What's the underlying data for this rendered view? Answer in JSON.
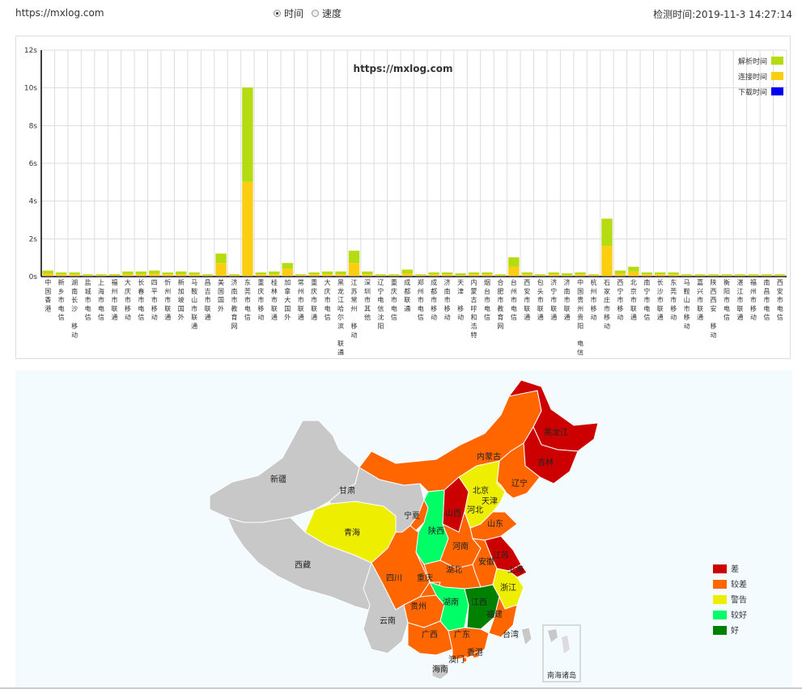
{
  "header": {
    "url": "https://mxlog.com",
    "radio_time": "时间",
    "radio_speed": "速度",
    "check_label": "检测时间:",
    "check_time": "2019-11-3 14:27:14"
  },
  "chart_data": {
    "type": "bar",
    "title": "https://mxlog.com",
    "ylim": [
      0,
      12
    ],
    "yticks": [
      "0s",
      "2s",
      "4s",
      "6s",
      "8s",
      "10s",
      "12s"
    ],
    "legend": [
      {
        "name": "解析时间",
        "color": "#b5dc10"
      },
      {
        "name": "连接时间",
        "color": "#fcce10"
      },
      {
        "name": "下载时间",
        "color": "#0000ee"
      }
    ],
    "legend_position": "top-right",
    "grid": true,
    "categories": [
      "中国香港",
      "新乡市电信",
      "湖南长沙 移动",
      "盐城市电信",
      "上海市电信",
      "福州市联通",
      "大庆市移动",
      "长春市电信",
      "四平市移动",
      "忻州市联通",
      "新加坡国外",
      "马鞍山市联通",
      "昌吉市联通",
      "美国国外",
      "济南市教育网",
      "东莞市电信",
      "重庆市移动",
      "桂林市联通",
      "加拿大国外",
      "常州市联通",
      "重庆市联通",
      "大庆市电信",
      "黑龙江哈尔滨 联通",
      "江苏常州 移动",
      "深圳市其他",
      "辽宁电信沈阳",
      "重庆市电信",
      "成都联通",
      "郑州市电信",
      "成都市移动",
      "济南市移动",
      "天津 移动",
      "内蒙古呼和浩特",
      "烟台市电信",
      "合肥市教育网",
      "台州市电信",
      "西安市联通",
      "包头市联通",
      "济宁市联通",
      "济南市联通",
      "中国贵州贵阳 电信",
      "杭州市移动",
      "石家庄市移动",
      "西宁市移动",
      "北京市联通",
      "南宁市电信",
      "长沙市联通",
      "东莞市移动",
      "马鞍山市移动",
      "嘉兴市联通",
      "陕西西安 移动",
      "衡阳市电信",
      "湛江市联通",
      "福州市移动",
      "南昌市电信",
      "西安市电信"
    ],
    "series": [
      {
        "name": "解析时间",
        "values": [
          0.15,
          0.1,
          0.1,
          0.05,
          0.05,
          0.05,
          0.15,
          0.15,
          0.15,
          0.1,
          0.15,
          0.1,
          0.05,
          0.5,
          0.05,
          5.0,
          0.1,
          0.15,
          0.3,
          0.05,
          0.1,
          0.15,
          0.15,
          0.65,
          0.15,
          0.05,
          0.05,
          0.2,
          0.05,
          0.1,
          0.1,
          0.1,
          0.1,
          0.1,
          0.05,
          0.5,
          0.1,
          0.05,
          0.1,
          0.1,
          0.1,
          0.05,
          1.45,
          0.15,
          0.25,
          0.1,
          0.1,
          0.1,
          0.05,
          0.05,
          0.05,
          0.05,
          0.05,
          0.05,
          0.05,
          0.05
        ]
      },
      {
        "name": "连接时间",
        "values": [
          0.15,
          0.1,
          0.1,
          0.05,
          0.05,
          0.05,
          0.1,
          0.1,
          0.15,
          0.1,
          0.1,
          0.1,
          0.05,
          0.7,
          0.05,
          5.0,
          0.1,
          0.1,
          0.4,
          0.05,
          0.1,
          0.1,
          0.1,
          0.7,
          0.1,
          0.05,
          0.05,
          0.15,
          0.05,
          0.1,
          0.1,
          0.05,
          0.1,
          0.1,
          0.05,
          0.5,
          0.1,
          0.05,
          0.1,
          0.05,
          0.1,
          0.05,
          1.6,
          0.15,
          0.25,
          0.1,
          0.1,
          0.1,
          0.05,
          0.05,
          0.05,
          0.05,
          0.05,
          0.05,
          0.05,
          0.05
        ]
      },
      {
        "name": "下载时间",
        "values": [
          0.02,
          0.02,
          0.02,
          0.02,
          0.02,
          0.03,
          0.02,
          0.02,
          0.02,
          0.02,
          0.02,
          0.02,
          0.02,
          0.02,
          0.02,
          0.02,
          0.02,
          0.02,
          0.02,
          0.02,
          0.02,
          0.02,
          0.02,
          0.02,
          0.02,
          0.02,
          0.02,
          0.02,
          0.02,
          0.02,
          0.02,
          0.02,
          0.02,
          0.02,
          0.02,
          0.02,
          0.02,
          0.02,
          0.02,
          0.02,
          0.02,
          0.02,
          0.02,
          0.02,
          0.02,
          0.02,
          0.02,
          0.02,
          0.02,
          0.02,
          0.02,
          0.02,
          0.02,
          0.02,
          0.02,
          0.02
        ]
      }
    ]
  },
  "map": {
    "legend": [
      {
        "name": "差",
        "color": "#cc0000"
      },
      {
        "name": "较差",
        "color": "#ff6600"
      },
      {
        "name": "警告",
        "color": "#eeee00"
      },
      {
        "name": "较好",
        "color": "#00ff66"
      },
      {
        "name": "好",
        "color": "#008000"
      }
    ],
    "provinces": [
      {
        "name": "新疆",
        "color": "#c8c8c8"
      },
      {
        "name": "西藏",
        "color": "#c8c8c8"
      },
      {
        "name": "青海",
        "color": "#eeee00"
      },
      {
        "name": "甘肃",
        "color": "#c8c8c8"
      },
      {
        "name": "内蒙古",
        "color": "#ff6600"
      },
      {
        "name": "黑龙江",
        "color": "#cc0000"
      },
      {
        "name": "吉林",
        "color": "#cc0000"
      },
      {
        "name": "辽宁",
        "color": "#ff6600"
      },
      {
        "name": "北京",
        "color": "#eeee00"
      },
      {
        "name": "天津",
        "color": "#eeee00"
      },
      {
        "name": "河北",
        "color": "#eeee00"
      },
      {
        "name": "宁夏",
        "color": "#ff6600"
      },
      {
        "name": "山西",
        "color": "#cc0000"
      },
      {
        "name": "陕西",
        "color": "#00ff66"
      },
      {
        "name": "山东",
        "color": "#ff6600"
      },
      {
        "name": "河南",
        "color": "#ff6600"
      },
      {
        "name": "江苏",
        "color": "#cc0000"
      },
      {
        "name": "安徽",
        "color": "#ff6600"
      },
      {
        "name": "上海",
        "color": "#cc0000"
      },
      {
        "name": "湖北",
        "color": "#ff6600"
      },
      {
        "name": "四川",
        "color": "#ff6600"
      },
      {
        "name": "重庆",
        "color": "#ff6600"
      },
      {
        "name": "浙江",
        "color": "#eeee00"
      },
      {
        "name": "贵州",
        "color": "#ff6600"
      },
      {
        "name": "湖南",
        "color": "#00ff66"
      },
      {
        "name": "江西",
        "color": "#008000"
      },
      {
        "name": "福建",
        "color": "#ff6600"
      },
      {
        "name": "云南",
        "color": "#c8c8c8"
      },
      {
        "name": "广西",
        "color": "#ff6600"
      },
      {
        "name": "广东",
        "color": "#ff6600"
      },
      {
        "name": "台湾",
        "color": "#c8c8c8"
      },
      {
        "name": "香港",
        "color": "#ff6600"
      },
      {
        "name": "澳门",
        "color": "#ff6600"
      },
      {
        "name": "海南",
        "color": "#c8c8c8"
      }
    ],
    "inset_label": "南海诸岛"
  }
}
